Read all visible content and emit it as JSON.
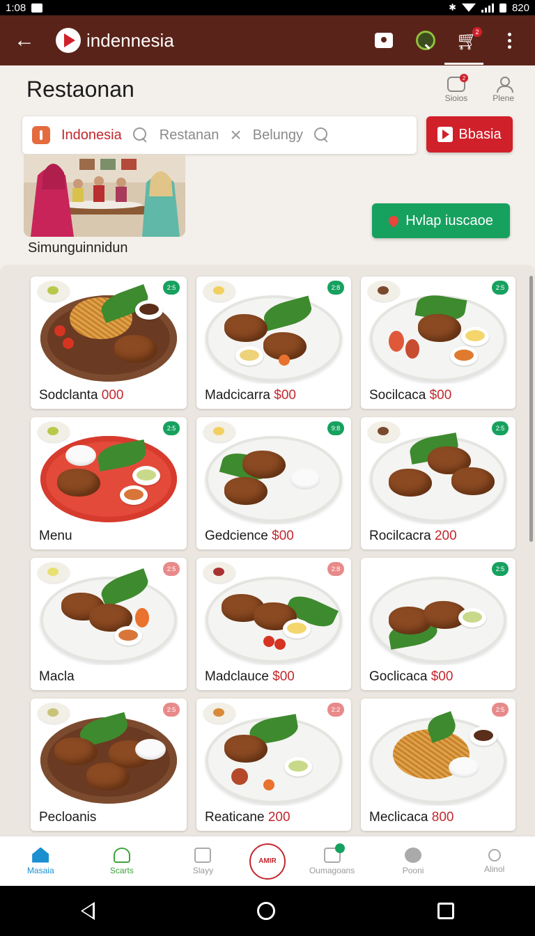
{
  "status_bar": {
    "time": "1:08",
    "battery": "820"
  },
  "app_bar": {
    "brand": "indennesia",
    "cart_badge": "2"
  },
  "header": {
    "title": "Restaonan",
    "tools": [
      {
        "label": "Sioios",
        "badge": "2"
      },
      {
        "label": "Plene"
      }
    ]
  },
  "search": {
    "country": "Indonesia",
    "field1": "Restanan",
    "field2": "Belungy",
    "cta_label": "Bbasia"
  },
  "hero": {
    "caption": "Simunguinnidun",
    "cta_label": "Hvlap iuscaoe"
  },
  "colors": {
    "brand_bar": "#5a2319",
    "accent_red": "#d0202a",
    "accent_green": "#17a15f",
    "price": "#c2272d"
  },
  "menu_items": [
    {
      "name": "Sodclanta",
      "price": "000",
      "tag": "2:5",
      "tag_color": "#17a15f"
    },
    {
      "name": "Madcicarra",
      "price": "$00",
      "tag": "2:8",
      "tag_color": "#17a15f"
    },
    {
      "name": "Socilcaca",
      "price": "$00",
      "tag": "2:5",
      "tag_color": "#17a15f"
    },
    {
      "name": "Menu",
      "price": "",
      "tag": "2:5",
      "tag_color": "#17a15f"
    },
    {
      "name": "Gedcience",
      "price": "$00",
      "tag": "9:8",
      "tag_color": "#17a15f"
    },
    {
      "name": "Rocilcacra",
      "price": "200",
      "tag": "2:5",
      "tag_color": "#17a15f"
    },
    {
      "name": "Macla",
      "price": "",
      "tag": "2:5",
      "tag_color": "#e88a8a"
    },
    {
      "name": "Madclauce",
      "price": "$00",
      "tag": "2:8",
      "tag_color": "#e88a8a"
    },
    {
      "name": "Goclicaca",
      "price": "$00",
      "tag": "2:5",
      "tag_color": "#17a15f"
    },
    {
      "name": "Pecloanis",
      "price": "",
      "tag": "2:5",
      "tag_color": "#e88a8a"
    },
    {
      "name": "Reaticane",
      "price": "200",
      "tag": "2:2",
      "tag_color": "#e88a8a"
    },
    {
      "name": "Meclicaca",
      "price": "800",
      "tag": "2:5",
      "tag_color": "#e88a8a"
    }
  ],
  "bottom_nav": [
    {
      "label": "Masaia",
      "icon": "home-icon"
    },
    {
      "label": "Scarts",
      "icon": "user-icon"
    },
    {
      "label": "Slayy",
      "icon": "document-icon"
    },
    {
      "label": "AMIR",
      "icon": "center-logo-icon"
    },
    {
      "label": "Oumagoans",
      "icon": "inbox-icon"
    },
    {
      "label": "Pooni",
      "icon": "cloud-icon"
    },
    {
      "label": "Alinol",
      "icon": "search-icon"
    }
  ]
}
